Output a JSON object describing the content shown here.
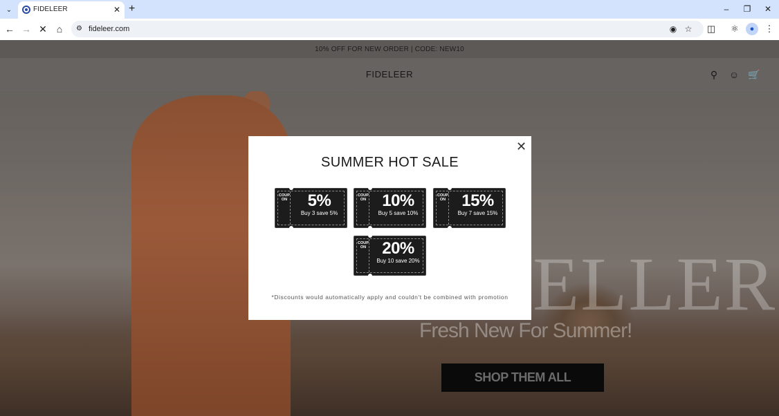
{
  "browser": {
    "tab_title": "FIDELEER",
    "url": "fideleer.com",
    "icons": {
      "tab_menu": "chevron-down-icon",
      "favicon": "site-favicon",
      "tab_close": "close-icon",
      "new_tab": "plus-icon",
      "minimize": "minimize-icon",
      "restore": "restore-icon",
      "close_window": "close-icon",
      "back": "arrow-left-icon",
      "forward": "arrow-right-icon",
      "stop": "stop-icon",
      "home": "home-icon",
      "site_info": "tune-icon",
      "eye_off": "eye-off-icon",
      "bookmark": "star-icon",
      "extensions": "puzzle-icon",
      "labs": "flask-icon",
      "profile": "avatar-icon",
      "menu": "kebab-icon"
    }
  },
  "site": {
    "announcement": "10% OFF FOR NEW ORDER | CODE: NEW10",
    "logo": "FIDELEER",
    "header_icons": [
      "search-icon",
      "account-icon",
      "cart-icon"
    ]
  },
  "hero": {
    "brand_script": "ELLERS",
    "tagline": "Fresh New For Summer!",
    "cta_label": "SHOP THEM ALL"
  },
  "modal": {
    "title": "SUMMER HOT SALE",
    "coupons": [
      {
        "stub": "COUPON",
        "percent": "5%",
        "desc": "Buy 3 save 5%"
      },
      {
        "stub": "COUPON",
        "percent": "10%",
        "desc": "Buy 5 save 10%"
      },
      {
        "stub": "COUPON",
        "percent": "15%",
        "desc": "Buy 7 save 15%"
      },
      {
        "stub": "COUPON",
        "percent": "20%",
        "desc": "Buy 10 save 20%"
      }
    ],
    "disclaimer": "*Discounts would automatically apply and couldn't be combined with promotion"
  }
}
